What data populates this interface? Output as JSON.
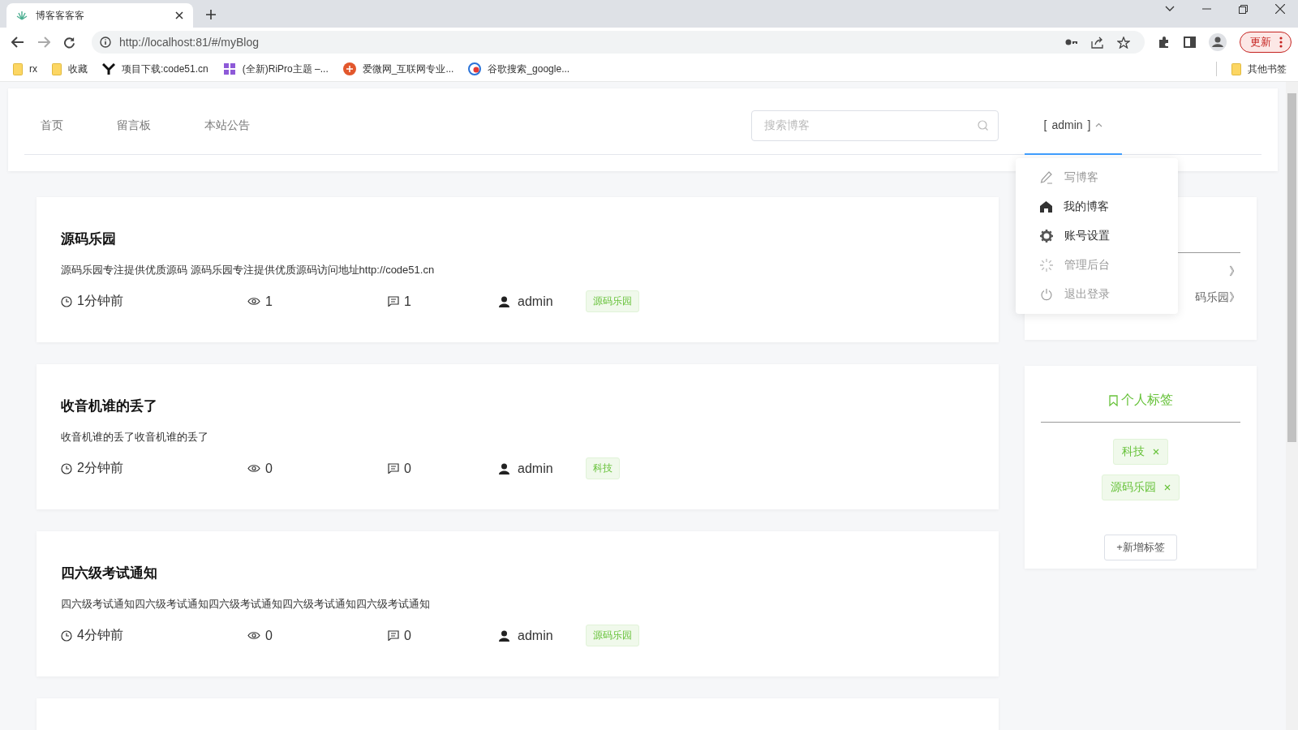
{
  "browser": {
    "tab_title": "博客客客客",
    "url": "http://localhost:81/#/myBlog",
    "update_button": "更新",
    "bookmarks": [
      {
        "label": "rx",
        "kind": "folder"
      },
      {
        "label": "收藏",
        "kind": "folder"
      },
      {
        "label": "项目下载:code51.cn",
        "kind": "y"
      },
      {
        "label": "(全新)RiPro主题 –...",
        "kind": "zy"
      },
      {
        "label": "爱微网_互联网专业...",
        "kind": "ai"
      },
      {
        "label": "谷歌搜索_google...",
        "kind": "g"
      }
    ],
    "other_bookmarks": "其他书签"
  },
  "nav": {
    "items": [
      "首页",
      "留言板",
      "本站公告"
    ],
    "search_placeholder": "搜索博客",
    "user": {
      "open_bracket": "[",
      "name": "admin",
      "close_bracket": "]"
    },
    "menu": [
      {
        "label": "写博客",
        "kind": "write",
        "dimmed": true
      },
      {
        "label": "我的博客",
        "kind": "home",
        "dimmed": false
      },
      {
        "label": "账号设置",
        "kind": "settings",
        "dimmed": false
      },
      {
        "label": "管理后台",
        "kind": "admin",
        "dimmed": true
      },
      {
        "label": "退出登录",
        "kind": "logout",
        "dimmed": true
      }
    ]
  },
  "posts": [
    {
      "title": "源码乐园",
      "summary": "源码乐园专注提供优质源码 源码乐园专注提供优质源码访问地址http://code51.cn",
      "time": "1分钟前",
      "views": "1",
      "comments": "1",
      "author": "admin",
      "tag": "源码乐园"
    },
    {
      "title": "收音机谁的丢了",
      "summary": "收音机谁的丢了收音机谁的丢了",
      "time": "2分钟前",
      "views": "0",
      "comments": "0",
      "author": "admin",
      "tag": "科技"
    },
    {
      "title": "四六级考试通知",
      "summary": "四六级考试通知四六级考试通知四六级考试通知四六级考试通知四六级考试通知",
      "time": "4分钟前",
      "views": "0",
      "comments": "0",
      "author": "admin",
      "tag": "源码乐园"
    }
  ],
  "side_card": {
    "lines": [
      "》",
      "码乐园》"
    ]
  },
  "tags_card": {
    "title": "个人标签",
    "tags": [
      "科技",
      "源码乐园"
    ],
    "add_button": "+新增标签"
  }
}
